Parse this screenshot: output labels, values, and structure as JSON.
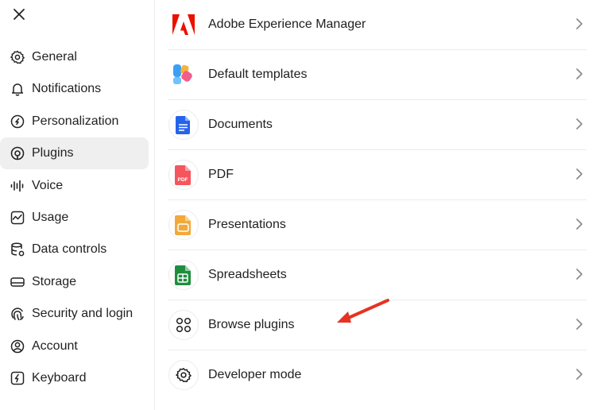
{
  "sidebar": {
    "items": [
      {
        "label": "General",
        "icon": "gear-icon",
        "active": false
      },
      {
        "label": "Notifications",
        "icon": "bell-icon",
        "active": false
      },
      {
        "label": "Personalization",
        "icon": "personalization-icon",
        "active": false
      },
      {
        "label": "Plugins",
        "icon": "plugins-icon",
        "active": true
      },
      {
        "label": "Voice",
        "icon": "voice-waveform-icon",
        "active": false
      },
      {
        "label": "Usage",
        "icon": "usage-chart-icon",
        "active": false
      },
      {
        "label": "Data controls",
        "icon": "database-icon",
        "active": false
      },
      {
        "label": "Storage",
        "icon": "storage-icon",
        "active": false
      },
      {
        "label": "Security and login",
        "icon": "fingerprint-icon",
        "active": false
      },
      {
        "label": "Account",
        "icon": "account-icon",
        "active": false
      },
      {
        "label": "Keyboard",
        "icon": "keyboard-icon",
        "active": false
      }
    ]
  },
  "plugins": {
    "items": [
      {
        "label": "Adobe Experience Manager",
        "icon": "adobe-logo-icon"
      },
      {
        "label": "Default templates",
        "icon": "templates-icon"
      },
      {
        "label": "Documents",
        "icon": "documents-icon"
      },
      {
        "label": "PDF",
        "icon": "pdf-icon",
        "badge": "PDF"
      },
      {
        "label": "Presentations",
        "icon": "presentations-icon"
      },
      {
        "label": "Spreadsheets",
        "icon": "spreadsheets-icon"
      },
      {
        "label": "Browse plugins",
        "icon": "browse-grid-icon"
      },
      {
        "label": "Developer mode",
        "icon": "gear-icon"
      }
    ]
  },
  "colors": {
    "adobe": "#eb1000",
    "docs": "#2563eb",
    "pdf": "#f5555d",
    "slides": "#f2a93b",
    "sheets": "#1e8e3e",
    "arrow": "#e53323",
    "active_bg": "#efefef"
  }
}
